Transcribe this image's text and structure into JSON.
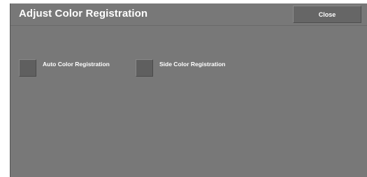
{
  "header": {
    "title": "Adjust Color Registration",
    "close_label": "Close"
  },
  "options": [
    {
      "label": "Auto Color Registration",
      "checked": false
    },
    {
      "label": "Side Color Registration",
      "checked": false
    }
  ],
  "colors": {
    "panel_background": "#787878",
    "button_background": "#666666",
    "text": "#ffffff"
  }
}
